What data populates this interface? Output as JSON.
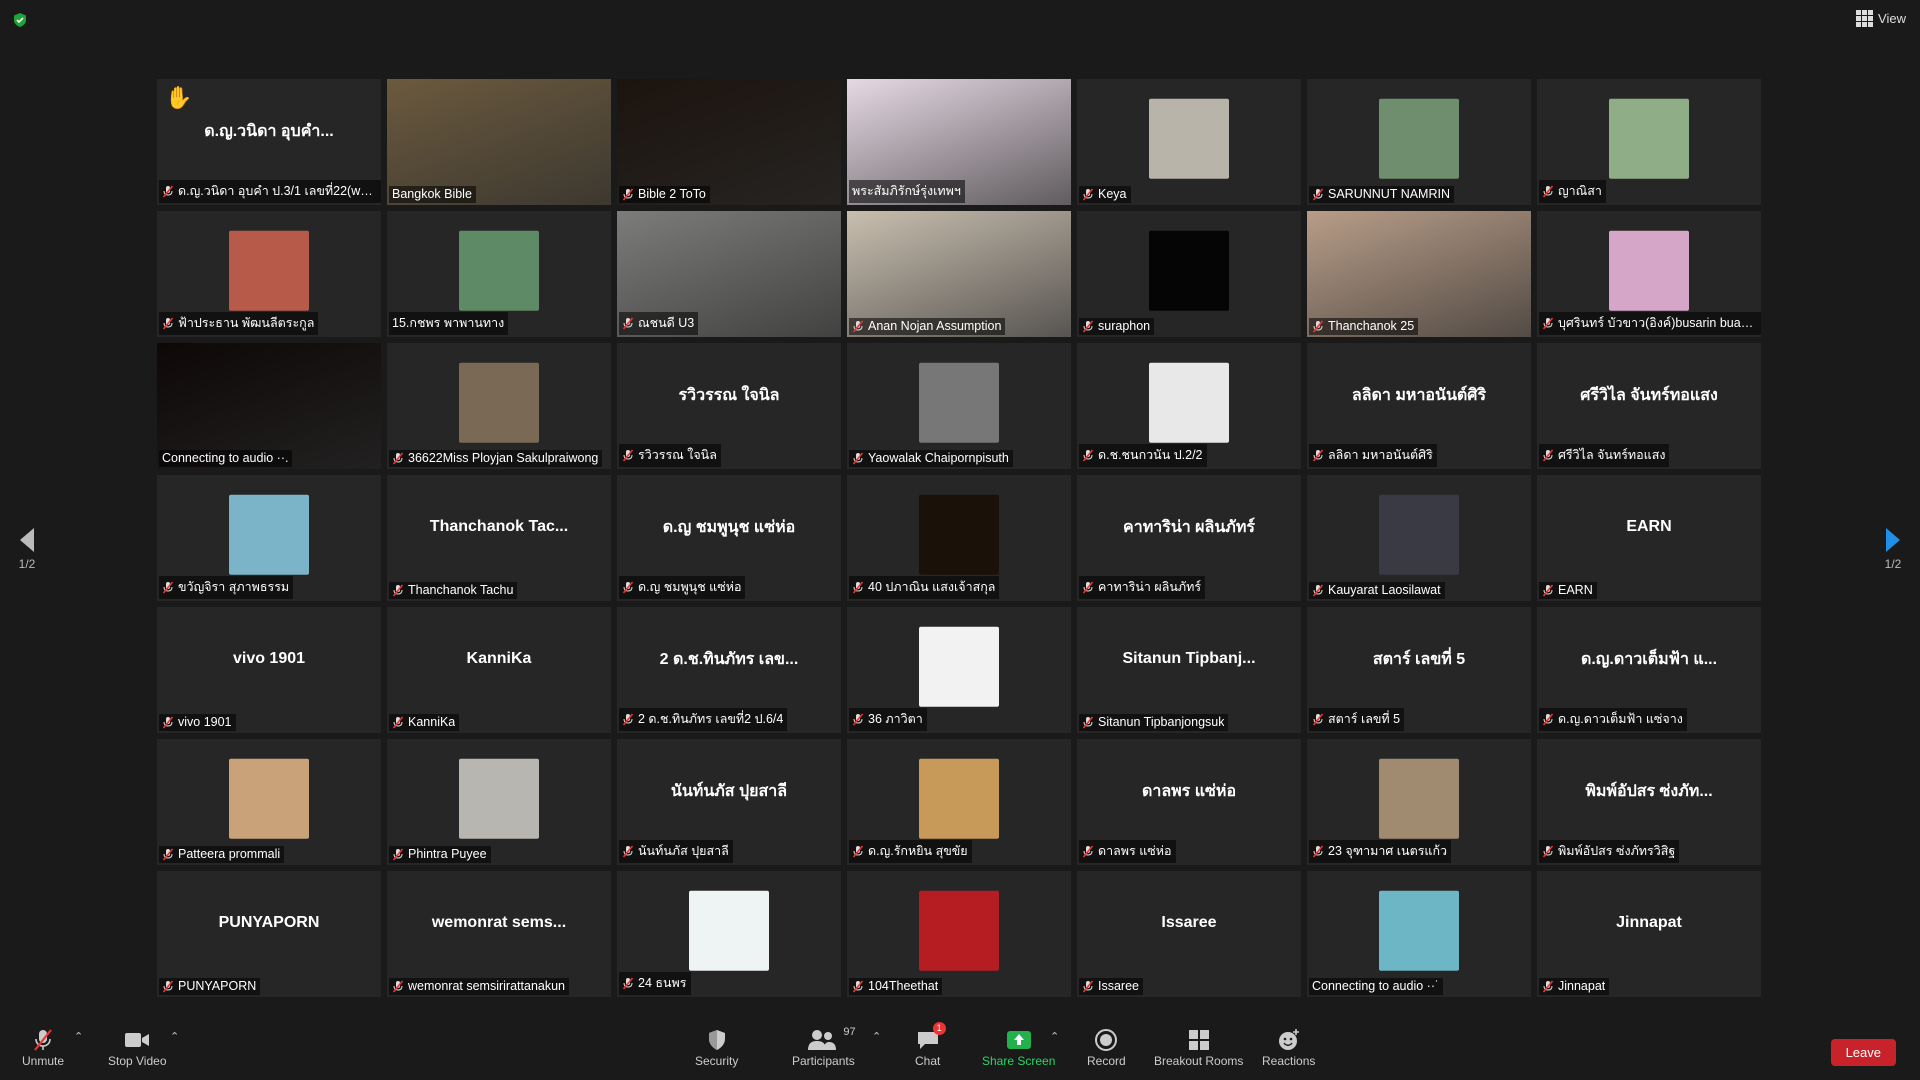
{
  "top": {
    "view_label": "View"
  },
  "nav": {
    "page_indicator_left": "1/2",
    "page_indicator_right": "1/2"
  },
  "toolbar": {
    "unmute": "Unmute",
    "stop_video": "Stop Video",
    "security": "Security",
    "participants": "Participants",
    "participants_count": "97",
    "chat": "Chat",
    "chat_badge": "1",
    "share_screen": "Share Screen",
    "record": "Record",
    "breakout_rooms": "Breakout Rooms",
    "reactions": "Reactions",
    "leave": "Leave"
  },
  "tiles": [
    {
      "center": "ด.ญ.วนิดา อุบคำ...",
      "label": "ด.ญ.วนิดา อุบคำ ป.3/1 เลขที่22(wani...",
      "muted": true,
      "kind": "name",
      "hand": true
    },
    {
      "center": "",
      "label": "Bangkok Bible",
      "muted": false,
      "kind": "video",
      "bg": "#6b5a3e",
      "active": true
    },
    {
      "center": "",
      "label": "Bible 2 ToTo",
      "muted": true,
      "kind": "video",
      "bg": "#1c140e"
    },
    {
      "center": "",
      "label": "พระสัมภิรักษ์รุ่งเทพฯ",
      "muted": false,
      "kind": "video",
      "bg": "#e6d9e4"
    },
    {
      "center": "",
      "label": "Keya",
      "muted": true,
      "kind": "pic",
      "bg": "#b8b4aa"
    },
    {
      "center": "",
      "label": "SARUNNUT NAMRIN",
      "muted": true,
      "kind": "pic",
      "bg": "#6f8e6e"
    },
    {
      "center": "",
      "label": "ญาณิสา",
      "muted": true,
      "kind": "pic",
      "bg": "#8fae87"
    },
    {
      "center": "",
      "label": "ฟ้าประธาน พัฒนลีตระกูล",
      "muted": true,
      "kind": "pic",
      "bg": "#b85a4a"
    },
    {
      "center": "",
      "label": "15.กชพร พาพานทาง",
      "muted": false,
      "kind": "pic",
      "bg": "#5f8a66"
    },
    {
      "center": "",
      "label": "ณชนดี U3",
      "muted": true,
      "kind": "video",
      "bg": "#7c7d7a"
    },
    {
      "center": "",
      "label": "Anan Nojan Assumption",
      "muted": true,
      "kind": "video",
      "bg": "#c9bfb0"
    },
    {
      "center": "",
      "label": "suraphon",
      "muted": true,
      "kind": "pic",
      "bg": "#050505"
    },
    {
      "center": "",
      "label": "Thanchanok 25",
      "muted": true,
      "kind": "video",
      "bg": "#b89d88"
    },
    {
      "center": "",
      "label": "บุศรินทร์ บัวขาว(อิงค์)busarin buakh...",
      "muted": true,
      "kind": "pic",
      "bg": "#d6a6c8"
    },
    {
      "center": "",
      "label": "Connecting to audio ··.",
      "muted": false,
      "kind": "video",
      "bg": "#0e0808"
    },
    {
      "center": "",
      "label": "36622Miss Ployjan Sakulpraiwong",
      "muted": true,
      "kind": "pic",
      "bg": "#7a6a55"
    },
    {
      "center": "รวิวรรณ ใจนิล",
      "label": "รวิวรรณ ใจนิล",
      "muted": true,
      "kind": "name"
    },
    {
      "center": "",
      "label": "Yaowalak Chaipornpisuth",
      "muted": true,
      "kind": "pic",
      "bg": "#777"
    },
    {
      "center": "",
      "label": "ด.ช.ชนกวนัน ป.2/2",
      "muted": true,
      "kind": "pic",
      "bg": "#e8e8e8"
    },
    {
      "center": "ลลิดา มหาอนันต์ศิริ",
      "label": "ลลิดา มหาอนันต์ศิริ",
      "muted": true,
      "kind": "name"
    },
    {
      "center": "ศรีวิไล จันทร์ทอแสง",
      "label": "ศรีวิไล จันทร์ทอแสง",
      "muted": true,
      "kind": "name"
    },
    {
      "center": "",
      "label": "ขวัญจิรา สุภาพธรรม",
      "muted": true,
      "kind": "pic",
      "bg": "#7bb3c8"
    },
    {
      "center": "Thanchanok Tac...",
      "label": "Thanchanok Tachu",
      "muted": true,
      "kind": "name"
    },
    {
      "center": "ด.ญ ชมพูนุช แซ่ห่อ",
      "label": "ด.ญ ชมพูนุช แซ่ห่อ",
      "muted": true,
      "kind": "name"
    },
    {
      "center": "",
      "label": "40 ปภาณิน แสงเจ้าสกุล",
      "muted": true,
      "kind": "pic",
      "bg": "#1a1208"
    },
    {
      "center": "คาทาริน่า ผลินภัทร์",
      "label": "คาทาริน่า ผลินภัทร์",
      "muted": true,
      "kind": "name"
    },
    {
      "center": "",
      "label": "Kauyarat Laosilawat",
      "muted": true,
      "kind": "pic",
      "bg": "#3a3a44"
    },
    {
      "center": "EARN",
      "label": "EARN",
      "muted": true,
      "kind": "name"
    },
    {
      "center": "vivo 1901",
      "label": "vivo 1901",
      "muted": true,
      "kind": "name"
    },
    {
      "center": "KanniKa",
      "label": "KanniKa",
      "muted": true,
      "kind": "name"
    },
    {
      "center": "2 ด.ช.ทินภัทร เลข...",
      "label": "2 ด.ช.ทินภัทร เลขที่2 ป.6/4",
      "muted": true,
      "kind": "name"
    },
    {
      "center": "",
      "label": "36 ภาวิตา",
      "muted": true,
      "kind": "pic",
      "bg": "#f2f2f2"
    },
    {
      "center": "Sitanun Tipbanj...",
      "label": "Sitanun Tipbanjongsuk",
      "muted": true,
      "kind": "name"
    },
    {
      "center": "สตาร์ เลขที่ 5",
      "label": "สตาร์ เลขที่ 5",
      "muted": true,
      "kind": "name"
    },
    {
      "center": "ด.ญ.ดาวเต็มฟ้า แ...",
      "label": "ด.ญ.ดาวเต็มฟ้า แซ่จาง",
      "muted": true,
      "kind": "name"
    },
    {
      "center": "",
      "label": "Patteera prommali",
      "muted": true,
      "kind": "pic",
      "bg": "#caa27a"
    },
    {
      "center": "",
      "label": "Phintra Puyee",
      "muted": true,
      "kind": "pic",
      "bg": "#b8b6b0"
    },
    {
      "center": "นันท์นภัส ปุยสาลี",
      "label": "นันท์นภัส ปุยสาลี",
      "muted": true,
      "kind": "name"
    },
    {
      "center": "",
      "label": "ด.ญ.รักหยิน สุขขัย",
      "muted": true,
      "kind": "pic",
      "bg": "#c79a5a"
    },
    {
      "center": "ดาลพร แซ่ห่อ",
      "label": "ดาลพร แซ่ห่อ",
      "muted": true,
      "kind": "name"
    },
    {
      "center": "",
      "label": "23 จุฑามาศ เนตรแก้ว",
      "muted": true,
      "kind": "pic",
      "bg": "#a08a70"
    },
    {
      "center": "พิมพ์อัปสร ซ่งภัท...",
      "label": "พิมพ์อัปสร ซ่งภัทรวิสิฐ",
      "muted": true,
      "kind": "name"
    },
    {
      "center": "PUNYAPORN",
      "label": "PUNYAPORN",
      "muted": true,
      "kind": "name"
    },
    {
      "center": "wemonrat  sems...",
      "label": "wemonrat  semsirirattanakun",
      "muted": true,
      "kind": "name"
    },
    {
      "center": "",
      "label": "24 ธนพร",
      "muted": true,
      "kind": "pic",
      "bg": "#eef3f4"
    },
    {
      "center": "",
      "label": "104Theethat",
      "muted": true,
      "kind": "pic",
      "bg": "#b51d22"
    },
    {
      "center": "Issaree",
      "label": "Issaree",
      "muted": true,
      "kind": "name"
    },
    {
      "center": "",
      "label": "Connecting to audio ··˙",
      "muted": false,
      "kind": "pic",
      "bg": "#6db6c6"
    },
    {
      "center": "Jinnapat",
      "label": "Jinnapat",
      "muted": true,
      "kind": "name"
    }
  ]
}
